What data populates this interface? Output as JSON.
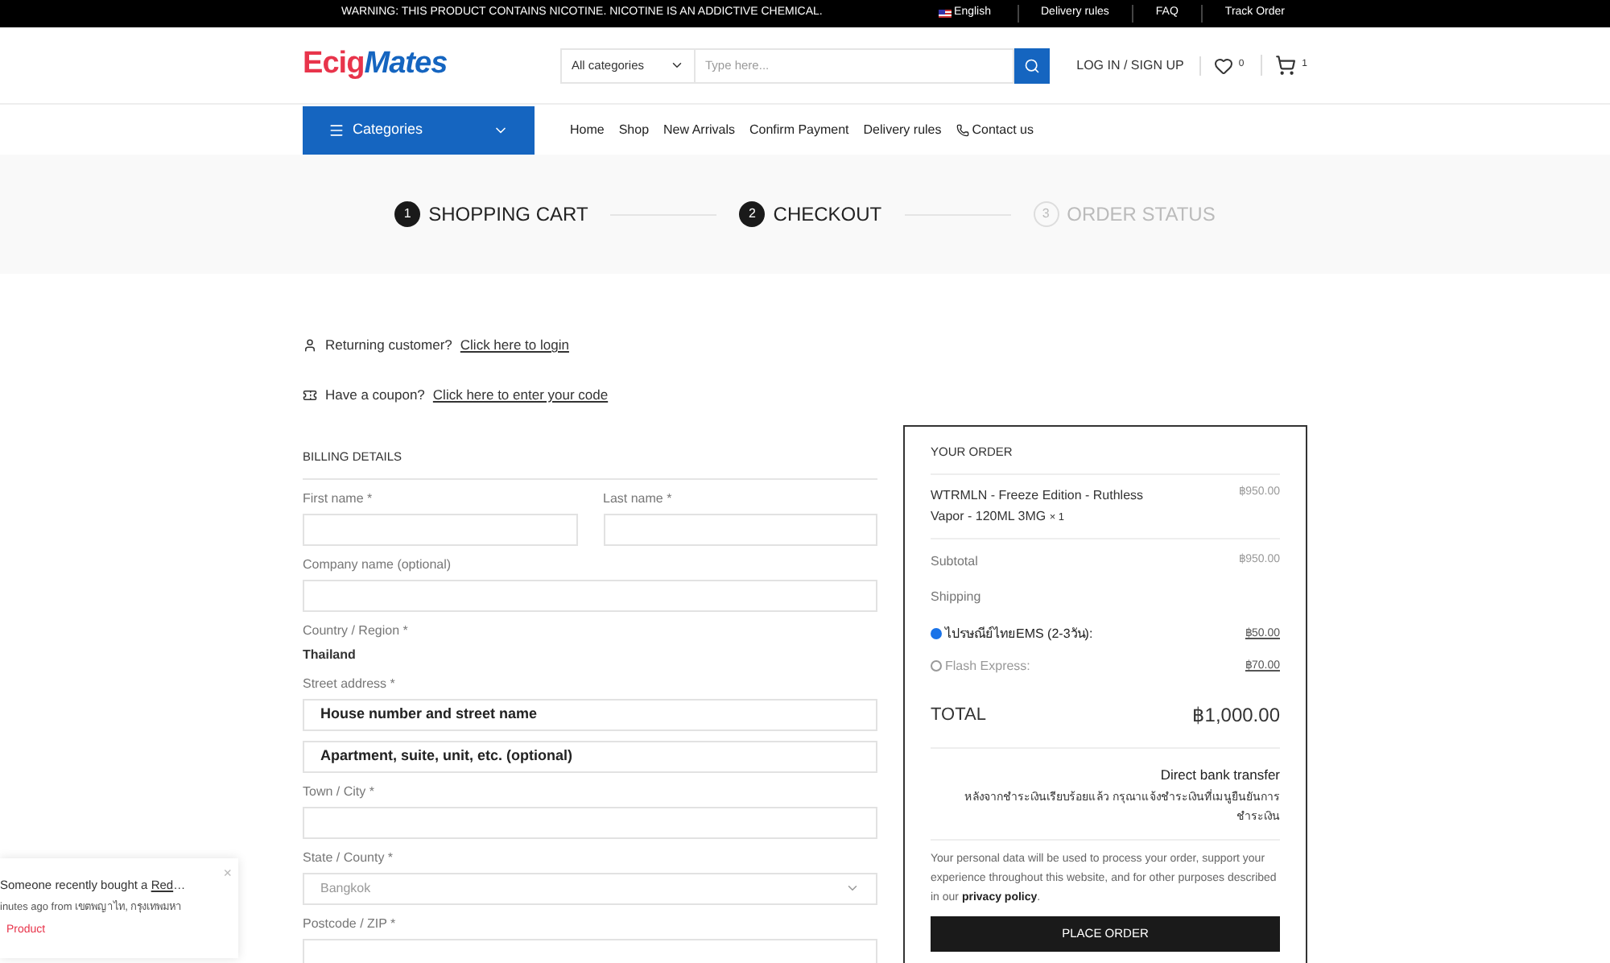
{
  "top_bar": {
    "warning": "WARNING: THIS PRODUCT CONTAINS NICOTINE. NICOTINE IS AN ADDICTIVE CHEMICAL.",
    "language": "English",
    "links": [
      "Delivery rules",
      "FAQ",
      "Track Order"
    ]
  },
  "header": {
    "logo": [
      "Ecig",
      "Mates"
    ],
    "category_select": "All categories",
    "search": {
      "placeholder": "Type here..."
    },
    "login": "LOG IN / SIGN UP",
    "wishlist_count": "0",
    "cart_count": "1"
  },
  "nav": {
    "categories": "Categories",
    "items": [
      {
        "label": "Home",
        "kind": "plain"
      },
      {
        "label": "Shop",
        "kind": "plain"
      },
      {
        "label": "New Arrivals",
        "kind": "plain"
      },
      {
        "label": "Confirm Payment",
        "kind": "plain"
      },
      {
        "label": "Delivery rules",
        "kind": "plain"
      },
      {
        "label": "Contact us",
        "kind": "phone"
      }
    ]
  },
  "steps": [
    {
      "number": "1",
      "label": "SHOPPING CART",
      "active": true
    },
    {
      "number": "2",
      "label": "CHECKOUT",
      "active": true
    },
    {
      "number": "3",
      "label": "ORDER STATUS",
      "active": false
    }
  ],
  "notices": [
    {
      "kind": "user",
      "text": "Returning customer?",
      "link": "Click here to login"
    },
    {
      "kind": "coupon",
      "text": "Have a coupon?",
      "link": "Click here to enter your code"
    }
  ],
  "billing": {
    "title": "BILLING DETAILS",
    "rows": [
      {
        "kind": "pair",
        "fields": [
          {
            "label": "First name *"
          },
          {
            "label": "Last name *"
          }
        ]
      },
      {
        "kind": "input",
        "label": "Company name (optional)"
      },
      {
        "kind": "value",
        "label": "Country / Region *",
        "value": "Thailand"
      },
      {
        "kind": "address",
        "label": "Street address *",
        "values": [
          "House number and street name",
          "Apartment, suite, unit, etc. (optional)"
        ]
      },
      {
        "kind": "input",
        "label": "Town / City *"
      },
      {
        "kind": "select",
        "label": "State / County *",
        "placeholder": "Bangkok"
      },
      {
        "kind": "input",
        "label": "Postcode / ZIP *"
      }
    ]
  },
  "order": {
    "title": "YOUR ORDER",
    "item": {
      "name": "WTRMLN - Freeze Edition - Ruthless Vapor - 120ML 3MG",
      "qty": "× 1",
      "price": "฿950.00"
    },
    "subtotal": {
      "label": "Subtotal",
      "value": "฿950.00"
    },
    "shipping_label": "Shipping",
    "shipping": [
      {
        "label": "ไปรษณีย์ไทยEMS (2-3วัน):",
        "price": "฿50.00",
        "selected": true
      },
      {
        "label": "Flash Express:",
        "price": "฿70.00",
        "selected": false
      }
    ],
    "total": {
      "label": "TOTAL",
      "value": "฿1,000.00"
    },
    "payment": {
      "method": "Direct bank transfer",
      "note": "หลังจากชำระเงินเรียบร้อยแล้ว กรุณาแจ้งชำระเงินที่เมนูยืนยันการชำระเงิน"
    },
    "privacy": {
      "text": "Your personal data will be used to process your order, support your experience throughout this website, and for other purposes described in our",
      "link": "privacy policy",
      "end": "."
    },
    "button": "PLACE ORDER"
  },
  "toast": {
    "text": "Someone recently bought a",
    "link": "Red",
    "ellipsis": "…",
    "time": "inutes ago from เขตพญาไท, กรุงเทพมหา",
    "tag": "Product",
    "close": "×"
  }
}
